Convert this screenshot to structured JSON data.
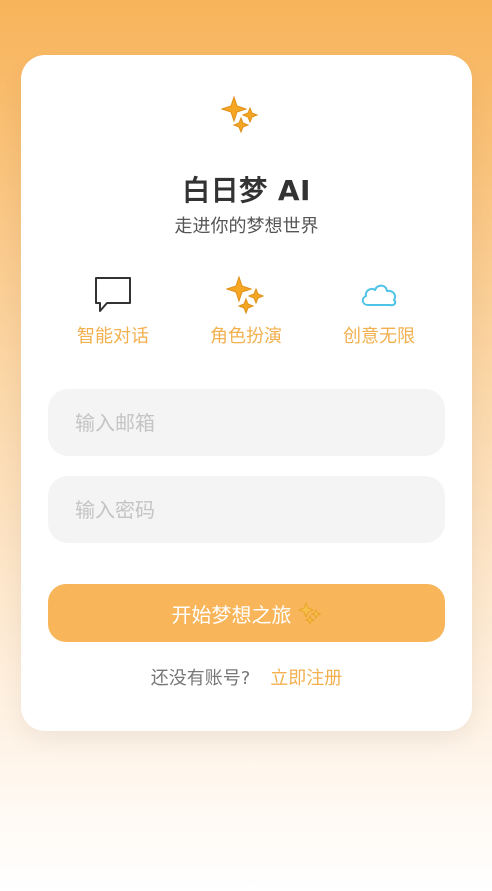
{
  "app": {
    "title": "白日梦 AI",
    "subtitle": "走进你的梦想世界"
  },
  "features": [
    {
      "label": "智能对话",
      "icon": "speech-bubble-icon"
    },
    {
      "label": "角色扮演",
      "icon": "sparkles-icon"
    },
    {
      "label": "创意无限",
      "icon": "cloud-icon"
    }
  ],
  "form": {
    "email_placeholder": "输入邮箱",
    "password_placeholder": "输入密码",
    "submit_label": "开始梦想之旅",
    "submit_icon": "sparkles-icon"
  },
  "signup": {
    "prompt": "还没有账号?",
    "link": "立即注册"
  },
  "colors": {
    "accent": "#f8b559",
    "accent_text": "#f2b04e",
    "cloud": "#4fc3e6",
    "title": "#333333"
  }
}
